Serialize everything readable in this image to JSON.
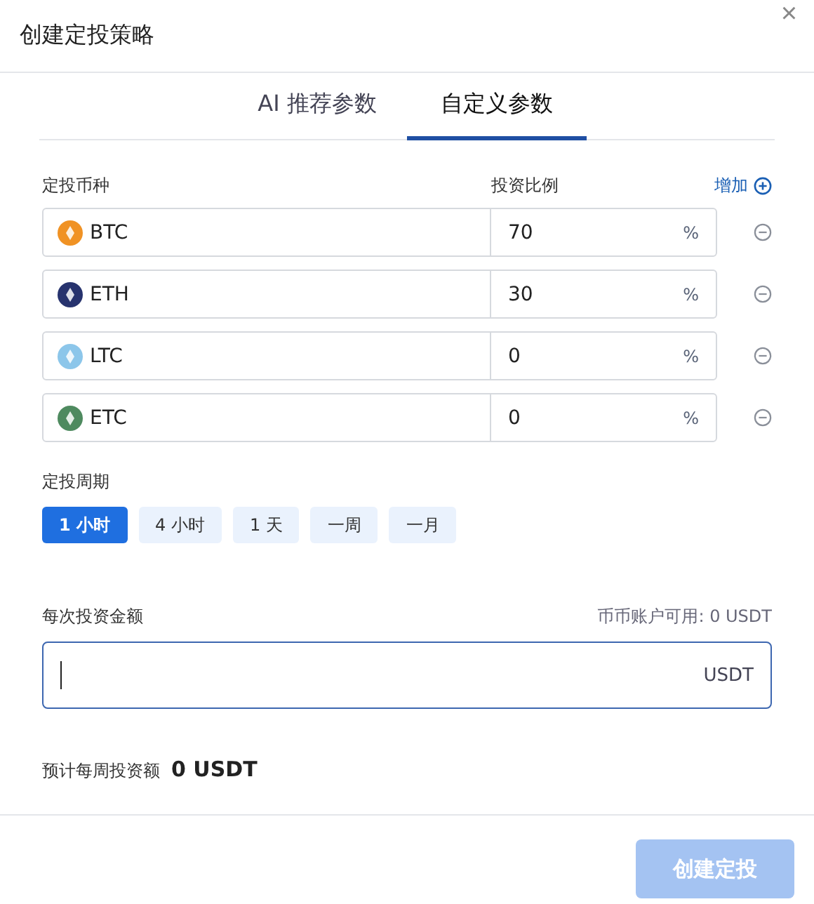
{
  "dialog": {
    "title": "创建定投策略",
    "close": "×"
  },
  "tabs": [
    {
      "label": "AI 推荐参数",
      "selected": false
    },
    {
      "label": "自定义参数",
      "selected": true
    }
  ],
  "coins_header": {
    "coin_label": "定投币种",
    "ratio_label": "投资比例",
    "add_label": "增加"
  },
  "coins": [
    {
      "symbol": "BTC",
      "color": "#f09224",
      "ratio": "70",
      "unit": "%"
    },
    {
      "symbol": "ETH",
      "color": "#27336e",
      "ratio": "30",
      "unit": "%"
    },
    {
      "symbol": "LTC",
      "color": "#8cc6ea",
      "ratio": "0",
      "unit": "%"
    },
    {
      "symbol": "ETC",
      "color": "#4e8a5f",
      "ratio": "0",
      "unit": "%"
    }
  ],
  "period": {
    "label": "定投周期",
    "options": [
      {
        "label": "1 小时",
        "selected": true
      },
      {
        "label": "4 小时",
        "selected": false
      },
      {
        "label": "1 天",
        "selected": false
      },
      {
        "label": "一周",
        "selected": false
      },
      {
        "label": "一月",
        "selected": false
      }
    ]
  },
  "amount": {
    "label": "每次投资金额",
    "available": "币币账户可用: 0 USDT",
    "unit": "USDT",
    "focused": true
  },
  "estimate": {
    "label": "预计每周投资额",
    "value": "0 USDT"
  },
  "submit": {
    "label": "创建定投",
    "disabled": true
  }
}
